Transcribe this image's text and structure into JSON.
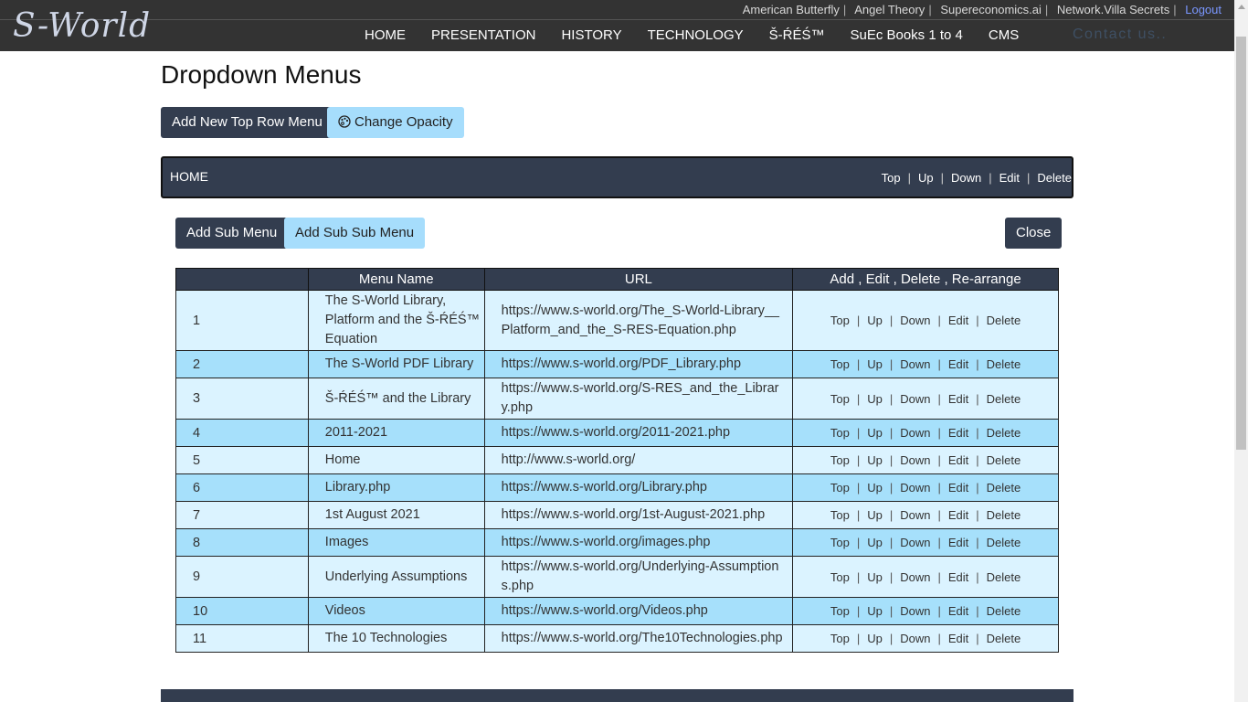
{
  "header": {
    "top_links": [
      "American Butterfly",
      "Angel Theory",
      "Supereconomics.ai",
      "Network.Villa Secrets"
    ],
    "logout": "Logout",
    "logo": "S-World",
    "nav": [
      "HOME",
      "PRESENTATION",
      "HISTORY",
      "TECHNOLOGY",
      "Š-ŔÉŚ™",
      "SuEc Books 1 to 4",
      "CMS"
    ],
    "contact": "Contact us.."
  },
  "page": {
    "title": "Dropdown Menus",
    "add_top_menu": "Add New Top Row Menu",
    "change_opacity": "Change Opacity"
  },
  "menubar": {
    "name": "HOME",
    "actions": [
      "Top",
      "Up",
      "Down",
      "Edit",
      "Delete"
    ]
  },
  "submenu": {
    "add_sub": "Add Sub Menu",
    "add_subsub": "Add Sub Sub Menu",
    "close": "Close",
    "columns": [
      "",
      "Menu Name",
      "URL",
      "Add , Edit , Delete , Re-arrange"
    ],
    "row_actions": [
      "Top",
      "Up",
      "Down",
      "Edit",
      "Delete"
    ],
    "rows": [
      {
        "num": "1",
        "name": "The S-World Library, Platform and the Š-ŔÉŚ™ Equation",
        "url": "https://www.s-world.org/The_S-World-Library__Platform_and_the_S-RES-Equation.php"
      },
      {
        "num": "2",
        "name": "The S-World PDF Library",
        "url": "https://www.s-world.org/PDF_Library.php"
      },
      {
        "num": "3",
        "name": "Š-ŔÉŚ™ and the Library",
        "url": "https://www.s-world.org/S-RES_and_the_Library.php"
      },
      {
        "num": "4",
        "name": "2011-2021",
        "url": "https://www.s-world.org/2011-2021.php"
      },
      {
        "num": "5",
        "name": "Home",
        "url": "http://www.s-world.org/"
      },
      {
        "num": "6",
        "name": "Library.php",
        "url": "https://www.s-world.org/Library.php"
      },
      {
        "num": "7",
        "name": "1st August 2021",
        "url": "https://www.s-world.org/1st-August-2021.php"
      },
      {
        "num": "8",
        "name": "Images",
        "url": "https://www.s-world.org/images.php"
      },
      {
        "num": "9",
        "name": "Underlying Assumptions",
        "url": "https://www.s-world.org/Underlying-Assumptions.php"
      },
      {
        "num": "10",
        "name": "Videos",
        "url": "https://www.s-world.org/Videos.php"
      },
      {
        "num": "11",
        "name": "The 10 Technologies",
        "url": "https://www.s-world.org/The10Technologies.php"
      }
    ]
  }
}
